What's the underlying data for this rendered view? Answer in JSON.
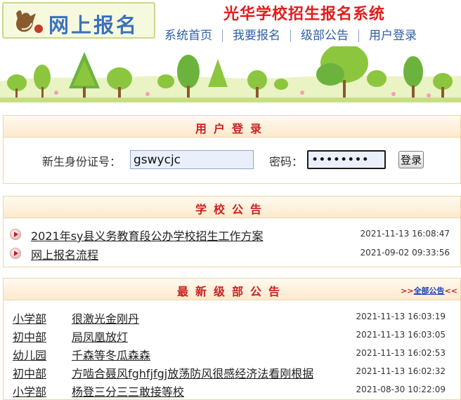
{
  "header": {
    "logo_text": "网上报名",
    "system_title": "光华学校招生报名系统",
    "nav": [
      "系统首页",
      "我要报名",
      "级部公告",
      "用户登录"
    ]
  },
  "login": {
    "title": "用户登录",
    "id_label": "新生身份证号：",
    "id_value": "gswycjc",
    "password_label": "密码：",
    "password_value": "••••••••",
    "button": "登录"
  },
  "school_notices": {
    "title": "学校公告",
    "items": [
      {
        "title": "2021年sy县义务教育段公办学校招生工作方案",
        "date": "2021-11-13 16:08:47"
      },
      {
        "title": "网上报名流程",
        "date": "2021-09-02 09:33:56"
      }
    ]
  },
  "dept_notices": {
    "title": "最新级部公告",
    "all_prefix": ">>",
    "all_link": "全部公告",
    "all_suffix": "<<",
    "items": [
      {
        "dept": "小学部",
        "title": "很激光金刚丹",
        "date": "2021-11-13 16:03:19"
      },
      {
        "dept": "初中部",
        "title": "局凤凰放灯",
        "date": "2021-11-13 16:03:05"
      },
      {
        "dept": "幼儿园",
        "title": "千森等冬瓜森森",
        "date": "2021-11-13 16:02:53"
      },
      {
        "dept": "初中部",
        "title": "方啮合聂风fghfjfgj放荡防风很感经济法看刚根据",
        "date": "2021-11-13 16:02:32"
      },
      {
        "dept": "小学部",
        "title": "杨登三分三三敢接等校",
        "date": "2021-08-30 10:22:09"
      }
    ]
  },
  "colors": {
    "title_red": "#e21b1b",
    "nav_blue": "#2d5fa8",
    "panel_border": "#efd5a8",
    "input_bg": "#e9f0fc"
  }
}
